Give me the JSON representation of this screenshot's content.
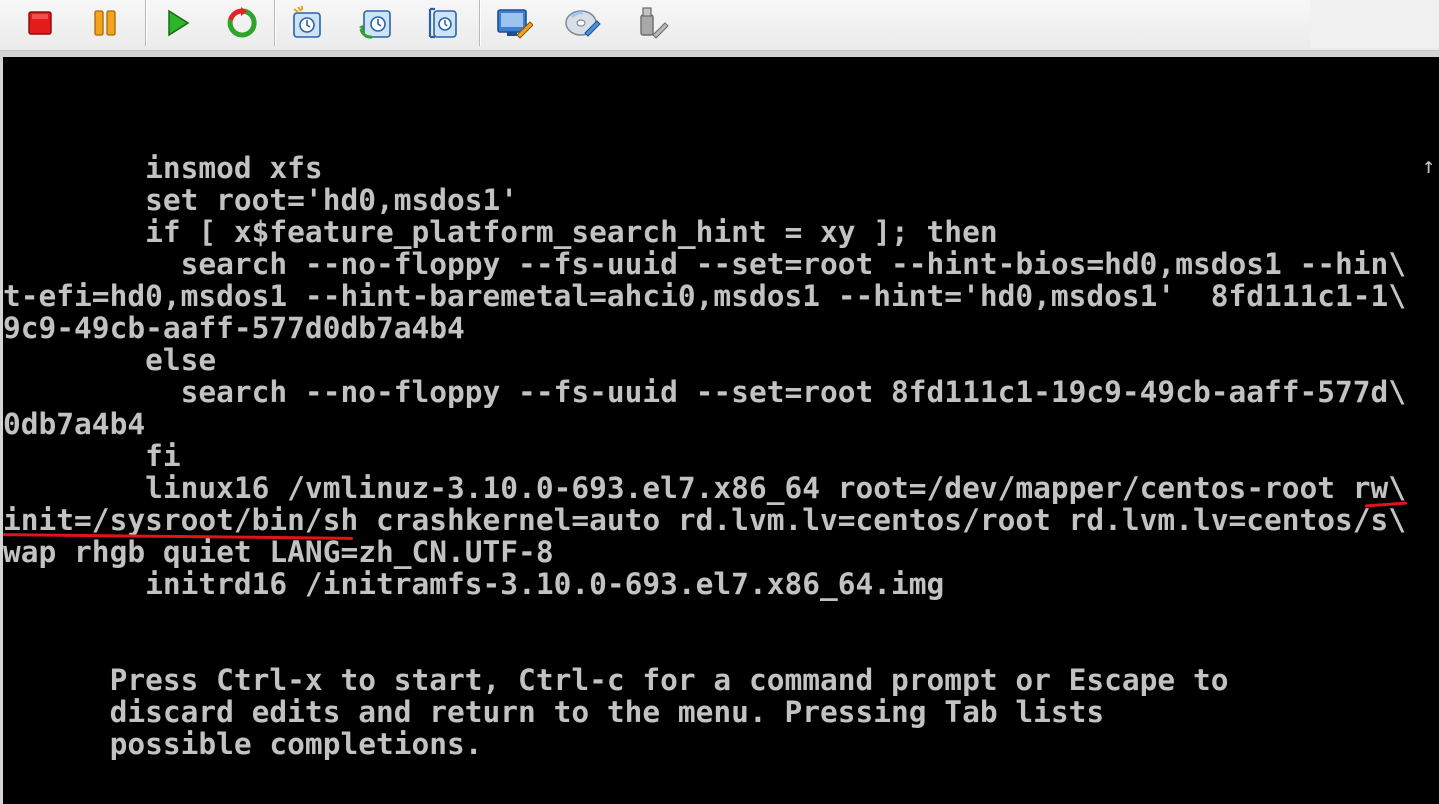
{
  "toolbar": {
    "buttons": [
      {
        "name": "stop-button",
        "icon": "stop-icon"
      },
      {
        "name": "pause-button",
        "icon": "pause-icon"
      },
      {
        "name": "play-button",
        "icon": "play-icon"
      },
      {
        "name": "reset-button",
        "icon": "reset-icon"
      },
      {
        "name": "take-snapshot-button",
        "icon": "snapshot-icon"
      },
      {
        "name": "revert-snapshot-button",
        "icon": "revert-snapshot-icon"
      },
      {
        "name": "snapshot-manager-button",
        "icon": "snapshot-manager-icon"
      },
      {
        "name": "edit-settings-button",
        "icon": "edit-settings-icon"
      },
      {
        "name": "cd-dvd-button",
        "icon": "cd-dvd-icon"
      },
      {
        "name": "devices-button",
        "icon": "usb-devices-icon"
      }
    ]
  },
  "console": {
    "lines": [
      "        insmod xfs",
      "        set root='hd0,msdos1'",
      "        if [ x$feature_platform_search_hint = xy ]; then",
      "          search --no-floppy --fs-uuid --set=root --hint-bios=hd0,msdos1 --hin\\",
      "t-efi=hd0,msdos1 --hint-baremetal=ahci0,msdos1 --hint='hd0,msdos1'  8fd111c1-1\\",
      "9c9-49cb-aaff-577d0db7a4b4",
      "        else",
      "          search --no-floppy --fs-uuid --set=root 8fd111c1-19c9-49cb-aaff-577d\\",
      "0db7a4b4",
      "        fi",
      "        linux16 /vmlinuz-3.10.0-693.el7.x86_64 root=/dev/mapper/centos-root rw\\",
      "init=/sysroot/bin/sh crashkernel=auto rd.lvm.lv=centos/root rd.lvm.lv=centos/s\\",
      "wap rhgb quiet LANG=zh_CN.UTF-8",
      "        initrd16 /initramfs-3.10.0-693.el7.x86_64.img",
      "",
      "",
      "      Press Ctrl-x to start, Ctrl-c for a command prompt or Escape to",
      "      discard edits and return to the menu. Pressing Tab lists",
      "      possible completions."
    ],
    "scroll_indicator": "↑"
  },
  "colors": {
    "console_bg": "#000000",
    "console_text": "#c2c2c2",
    "annotation": "#e0141a"
  }
}
